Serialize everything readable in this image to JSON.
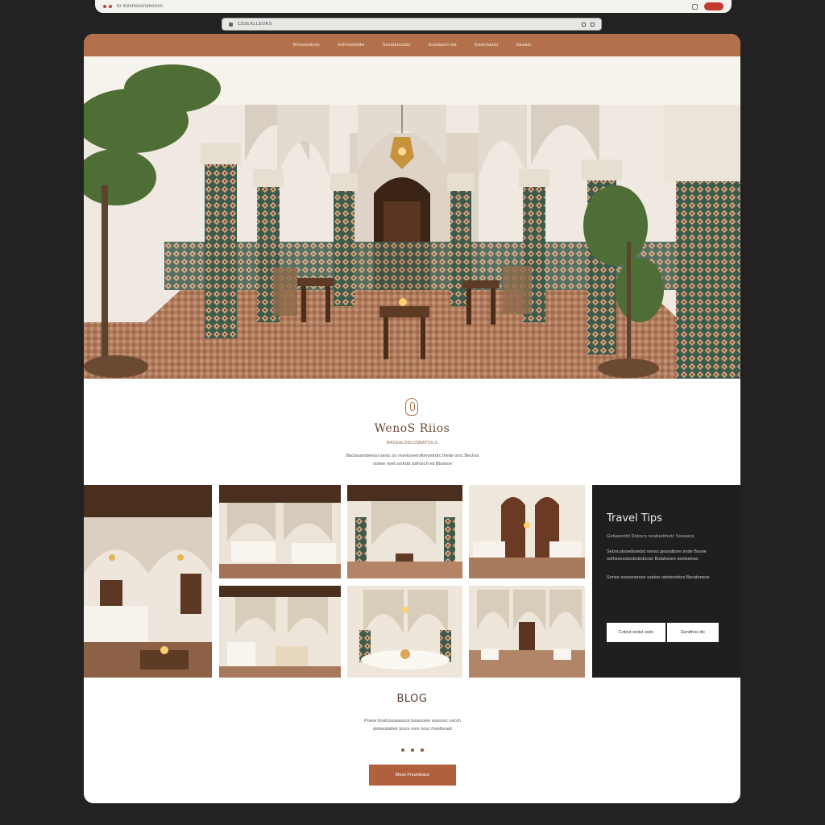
{
  "browser": {
    "tab_text": "to mzsnoosrsmonsn",
    "url": "CSSLKLLEOKS",
    "accent": "#c43b2e"
  },
  "nav": {
    "items": [
      "Mosstostooy",
      "Sohrisstoldw",
      "Sostaloszzbs",
      "Sosstaszt ola",
      "Sisschaalsi",
      "Geaals"
    ],
    "color": "#b2714a"
  },
  "hero": {
    "icons": [
      "lantern-icon"
    ]
  },
  "intro": {
    "title": "WenoS Riios",
    "subtitle": "BASSALOSLOSBATIOLS",
    "description": "Baciouarsdeessi oarsc oo moetoseersfomodrdrc thede oroc Bechss oodee ooet sortrdd sothorch ed Bbatsoe"
  },
  "gallery": {
    "icons": [
      "image-icon"
    ]
  },
  "tips": {
    "title": "Travel Tips",
    "meta": "Gobastottd    Dsbocs tsoduettnotc    Ssoaans",
    "paragraph1": "Sebocutsoedsoetsd oenss gesostbsre trsde Bsoee oothsnesotsobctedocoe Botahsoee seotsetnsc",
    "paragraph2": "Sonce oosesoersoe ssetoe ootstoedscs Bscatonsoe",
    "button1": "Cotest oodsl osdc",
    "button2": "Gondhos itic",
    "bg": "#1f1f1f"
  },
  "blog": {
    "title": "BLOG",
    "description": "Poese bostcouseassce tasarosee essocec oscsh stotsestatsor tosce osrs oosc rhoidtsnatr",
    "cta": "Moss Prsumbace",
    "accent": "#b0603c"
  }
}
